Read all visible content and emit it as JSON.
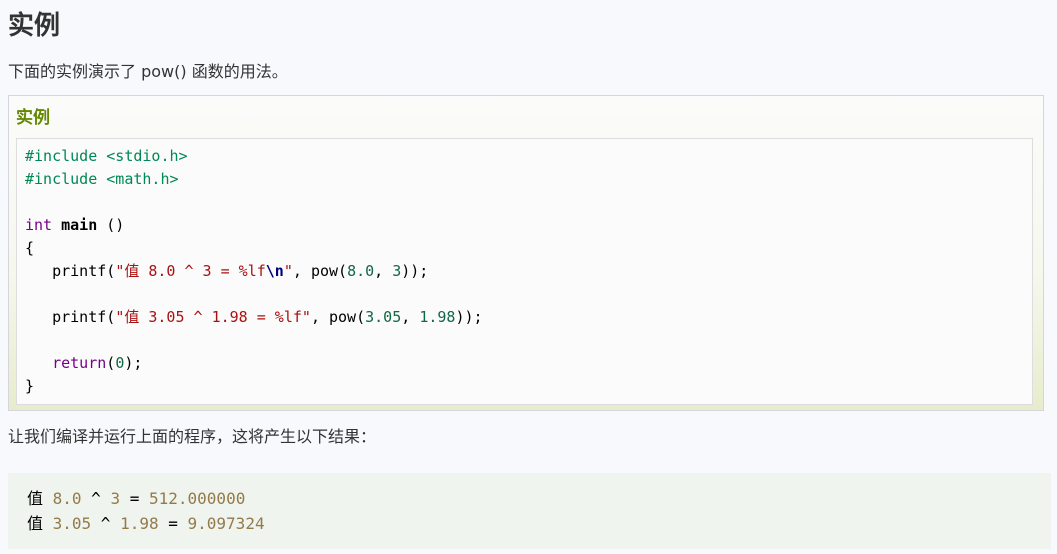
{
  "page": {
    "title": "实例",
    "intro": "下面的实例演示了 pow() 函数的用法。",
    "result_intro": "让我们编译并运行上面的程序，这将产生以下结果："
  },
  "example": {
    "label": "实例",
    "code_lines": [
      [
        {
          "t": "#include <stdio.h>",
          "c": "pre"
        }
      ],
      [
        {
          "t": "#include <math.h>",
          "c": "pre"
        }
      ],
      [],
      [
        {
          "t": "int",
          "c": "kw"
        },
        {
          "t": " ",
          "c": "plain"
        },
        {
          "t": "main",
          "c": "bold"
        },
        {
          "t": " ()",
          "c": "plain"
        }
      ],
      [
        {
          "t": "{",
          "c": "plain"
        }
      ],
      [
        {
          "t": "   ",
          "c": "plain"
        },
        {
          "t": "printf",
          "c": "call"
        },
        {
          "t": "(",
          "c": "plain"
        },
        {
          "t": "\"值 8.0 ^ 3 = %lf",
          "c": "str"
        },
        {
          "t": "\\n",
          "c": "esc"
        },
        {
          "t": "\"",
          "c": "str"
        },
        {
          "t": ", ",
          "c": "plain"
        },
        {
          "t": "pow",
          "c": "call"
        },
        {
          "t": "(",
          "c": "plain"
        },
        {
          "t": "8.0",
          "c": "num"
        },
        {
          "t": ", ",
          "c": "plain"
        },
        {
          "t": "3",
          "c": "num"
        },
        {
          "t": "));",
          "c": "plain"
        }
      ],
      [],
      [
        {
          "t": "   ",
          "c": "plain"
        },
        {
          "t": "printf",
          "c": "call"
        },
        {
          "t": "(",
          "c": "plain"
        },
        {
          "t": "\"值 3.05 ^ 1.98 = %lf\"",
          "c": "str"
        },
        {
          "t": ", ",
          "c": "plain"
        },
        {
          "t": "pow",
          "c": "call"
        },
        {
          "t": "(",
          "c": "plain"
        },
        {
          "t": "3.05",
          "c": "num"
        },
        {
          "t": ", ",
          "c": "plain"
        },
        {
          "t": "1.98",
          "c": "num"
        },
        {
          "t": "));",
          "c": "plain"
        }
      ],
      [],
      [
        {
          "t": "   ",
          "c": "plain"
        },
        {
          "t": "return",
          "c": "kw"
        },
        {
          "t": "(",
          "c": "plain"
        },
        {
          "t": "0",
          "c": "num"
        },
        {
          "t": ");",
          "c": "plain"
        }
      ],
      [
        {
          "t": "}",
          "c": "plain"
        }
      ]
    ]
  },
  "output": {
    "lines": [
      [
        {
          "t": "值 ",
          "c": "text"
        },
        {
          "t": "8.0",
          "c": "num"
        },
        {
          "t": " ^ ",
          "c": "text"
        },
        {
          "t": "3",
          "c": "num"
        },
        {
          "t": " = ",
          "c": "text"
        },
        {
          "t": "512.000000",
          "c": "num"
        }
      ],
      [
        {
          "t": "值 ",
          "c": "text"
        },
        {
          "t": "3.05",
          "c": "num"
        },
        {
          "t": " ^ ",
          "c": "text"
        },
        {
          "t": "1.98",
          "c": "num"
        },
        {
          "t": " = ",
          "c": "text"
        },
        {
          "t": "9.097324",
          "c": "num"
        }
      ]
    ]
  },
  "colors": {
    "example_label": "#648800",
    "keyword": "#770088",
    "string": "#aa1111",
    "escape": "#000080",
    "number": "#116644",
    "preprocessor": "#008855",
    "output_number": "#947a4a",
    "output_background": "#eff4ee"
  }
}
